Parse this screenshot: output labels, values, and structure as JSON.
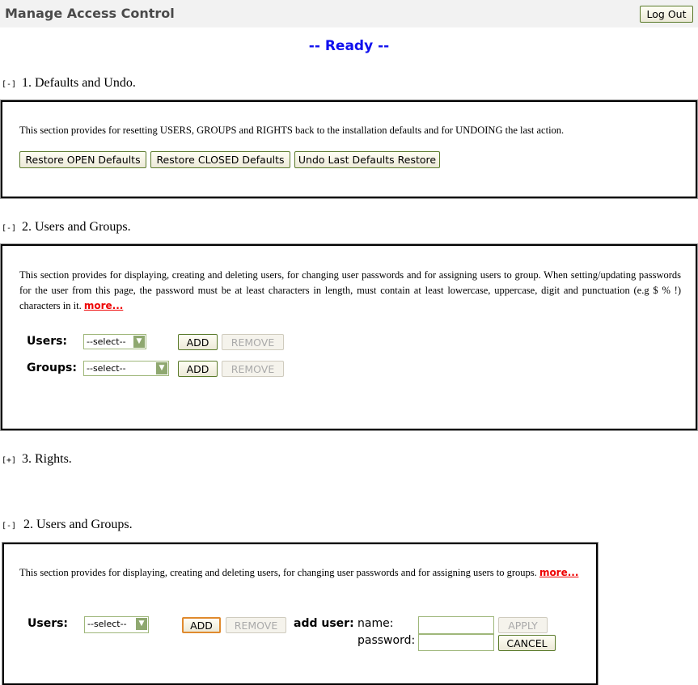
{
  "header": {
    "title": "Manage Access Control",
    "logout_label": "Log Out"
  },
  "status": "-- Ready --",
  "sections": [
    {
      "toggle": "[-]",
      "title": "1. Defaults and Undo.",
      "description": "This section provides for resetting USERS, GROUPS and RIGHTS back to the installation defaults and for UNDOING the last action.",
      "buttons": [
        "Restore OPEN Defaults",
        "Restore CLOSED Defaults",
        "Undo Last Defaults Restore"
      ]
    },
    {
      "toggle": "[-]",
      "title": "2. Users and Groups.",
      "description": "This section provides for displaying, creating and deleting users, for changing user passwords and for assigning users to group. When setting/updating passwords for the user from this page, the password must be at least characters in length, must contain at least lowercase, uppercase, digit and punctuation (e.g $ % !) characters in it.",
      "more": "more...",
      "users_label": "Users:",
      "groups_label": "Groups:",
      "select_value": "--select--",
      "add_label": "ADD",
      "remove_label": "REMOVE"
    },
    {
      "toggle": "[+]",
      "title": "3. Rights."
    },
    {
      "toggle": "[-]",
      "title": "2. Users and Groups.",
      "description": "This section provides for displaying, creating and deleting users, for changing user passwords and for assigning users to groups.",
      "more": "more...",
      "users_label": "Users:",
      "select_value": "--select--",
      "add_label": "ADD",
      "remove_label": "REMOVE",
      "add_user_label": "add user:",
      "name_label": "name:",
      "password_label": "password:",
      "name_value": "",
      "password_value": "",
      "apply_label": "APPLY",
      "cancel_label": "CANCEL"
    }
  ]
}
